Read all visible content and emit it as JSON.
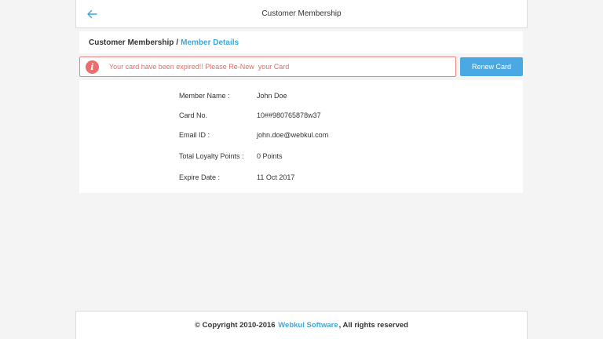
{
  "header": {
    "title": "Customer Membership",
    "back_icon": "arrow-left-icon"
  },
  "breadcrumb": {
    "parent": "Customer Membership",
    "separator": "/",
    "current": "Member Details"
  },
  "alert": {
    "icon": "info-icon",
    "icon_glyph": "i",
    "message": "Your card have been expired!! Please Re-New  your Card"
  },
  "renew_button": {
    "label": "Renew Card"
  },
  "member": {
    "rows": [
      {
        "label": "Member Name :",
        "value": "John Doe"
      },
      {
        "label": "Card No.",
        "value": "10##980765878w37"
      },
      {
        "label": "Email ID :",
        "value": "john.doe@webkul.com"
      },
      {
        "label": "Total Loyalty Points :",
        "value": "0 Points"
      },
      {
        "label": "Expire Date :",
        "value": "11 Oct 2017"
      }
    ]
  },
  "footer": {
    "prefix": "© Copyright 2010-2016",
    "company": "Webkul Software",
    "suffix": ", All rights reserved"
  },
  "colors": {
    "accent": "#3fa5dd",
    "button": "#4aa9e2",
    "alert": "#e26a6a",
    "background": "#f4f4f4"
  }
}
